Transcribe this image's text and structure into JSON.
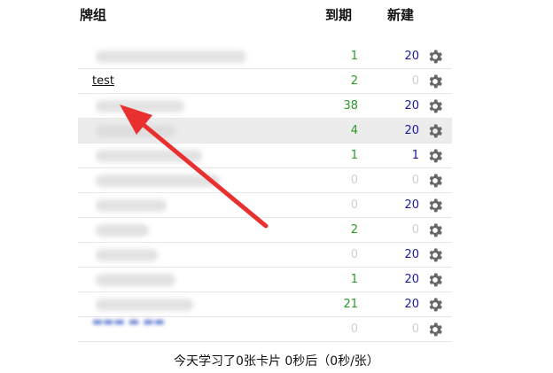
{
  "header": {
    "deck": "牌组",
    "due": "到期",
    "new": "新建"
  },
  "decks": [
    {
      "name": "",
      "due": "1",
      "new": "20"
    },
    {
      "name": "test",
      "due": "2",
      "new": "0"
    },
    {
      "name": "",
      "due": "38",
      "new": "20"
    },
    {
      "name": "",
      "due": "4",
      "new": "20"
    },
    {
      "name": "",
      "due": "1",
      "new": "1"
    },
    {
      "name": "",
      "due": "0",
      "new": "0"
    },
    {
      "name": "",
      "due": "0",
      "new": "20"
    },
    {
      "name": "",
      "due": "2",
      "new": "0"
    },
    {
      "name": "",
      "due": "0",
      "new": "20"
    },
    {
      "name": "",
      "due": "1",
      "new": "20"
    },
    {
      "name": "",
      "due": "21",
      "new": "20"
    },
    {
      "name": "",
      "due": "0",
      "new": "0"
    }
  ],
  "footer": {
    "stats": "今天学习了0张卡片 0秒后（0秒/张）"
  },
  "icons": {
    "options": "gear-icon",
    "pointer": "red-arrow-annotation"
  },
  "colors": {
    "due": "#2a9a2a",
    "new": "#1a1aa0",
    "zero": "#d0d0d0",
    "arrow": "#e8302f"
  }
}
